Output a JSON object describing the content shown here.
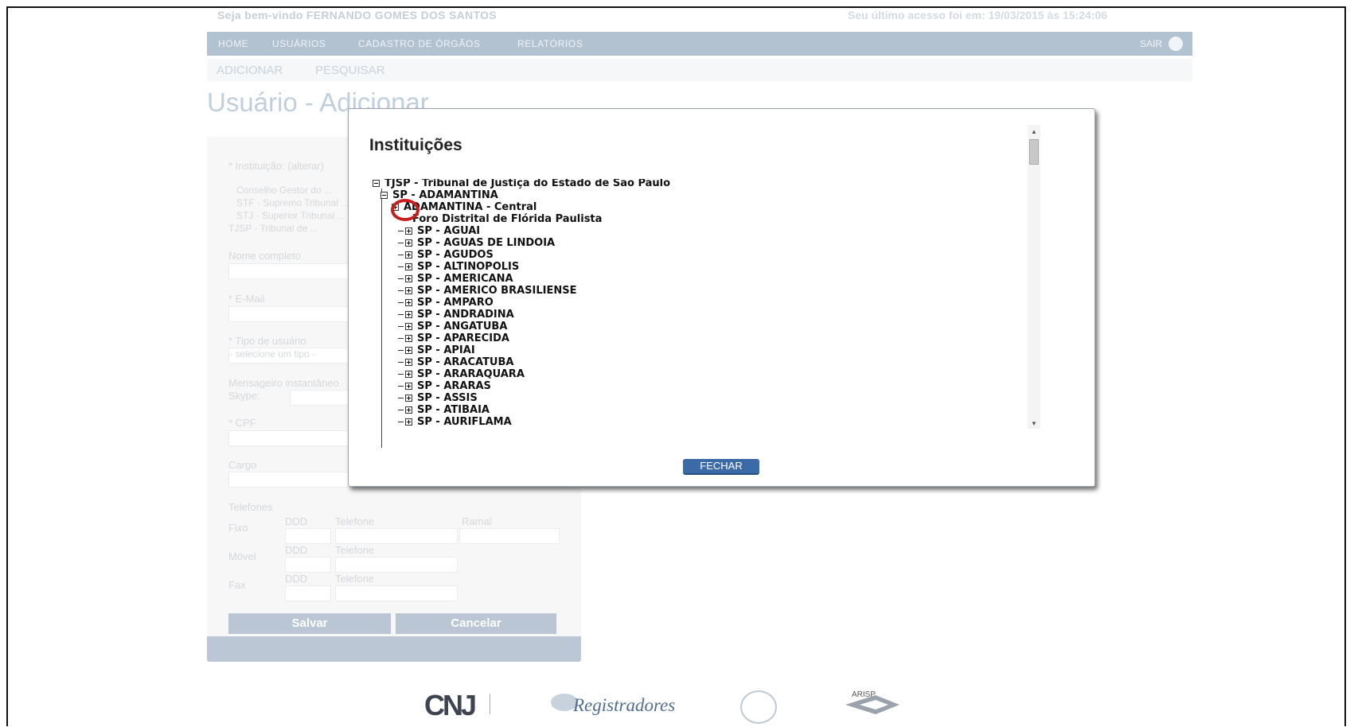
{
  "header": {
    "welcome": "Seja bem-vindo FERNANDO GOMES DOS SANTOS",
    "last_access": "Seu último acesso foi em: 19/03/2015 às 15:24:06"
  },
  "nav": {
    "items": [
      "HOME",
      "USUÁRIOS",
      "CADASTRO DE ÓRGÃOS",
      "RELATÓRIOS"
    ],
    "logout": "SAIR"
  },
  "subnav": {
    "add": "ADICIONAR",
    "search": "PESQUISAR"
  },
  "page": {
    "title": "Usuário - Adicionar"
  },
  "form": {
    "institution_label": "* Instituição: (alterar)",
    "institution_lines": [
      "Conselho Gestor do ...",
      "STF - Supremo Tribunal ...",
      "STJ - Superior Tribunal ...",
      "TJSP - Tribunal de ..."
    ],
    "name_label": "Nome completo",
    "email_label": "* E-Mail",
    "user_type_label": "* Tipo de usuário",
    "user_type_placeholder": "- selecione um tipo -",
    "messenger_label": "Mensageiro instantâneo",
    "skype_label": "Skype:",
    "cpf_label": "* CPF",
    "role_label": "Cargo",
    "phones_label": "Telefones",
    "phone_rows": [
      {
        "label": "Fixo",
        "ddd": "DDD",
        "phone": "Telefone",
        "ext": "Ramal"
      },
      {
        "label": "Móvel",
        "ddd": "DDD",
        "phone": "Telefone"
      },
      {
        "label": "Fax",
        "ddd": "DDD",
        "phone": "Telefone"
      }
    ],
    "save_label": "Salvar",
    "cancel_label": "Cancelar"
  },
  "footer_logos": {
    "cnj": "CNJ",
    "registradores": "Registradores",
    "arisp": "ARISP"
  },
  "modal": {
    "title": "Instituições",
    "root": "TJSP - Tribunal de Justiça do Estado de São Paulo",
    "expanded_node": "SP - ADAMANTINA",
    "children": [
      "ADAMANTINA - Central",
      "Foro Distrital de Flórida Paulista"
    ],
    "nodes": [
      "SP - AGUAI",
      "SP - AGUAS DE LINDOIA",
      "SP - AGUDOS",
      "SP - ALTINOPOLIS",
      "SP - AMERICANA",
      "SP - AMERICO BRASILIENSE",
      "SP - AMPARO",
      "SP - ANDRADINA",
      "SP - ANGATUBA",
      "SP - APARECIDA",
      "SP - APIAI",
      "SP - ARACATUBA",
      "SP - ARARAQUARA",
      "SP - ARARAS",
      "SP - ASSIS",
      "SP - ATIBAIA",
      "SP - AURIFLAMA"
    ],
    "close_label": "FECHAR"
  },
  "colors": {
    "annotation_circle": "#c81d1d",
    "close_button": "#3c6aa6",
    "nav_bar": "#4b6f94"
  }
}
